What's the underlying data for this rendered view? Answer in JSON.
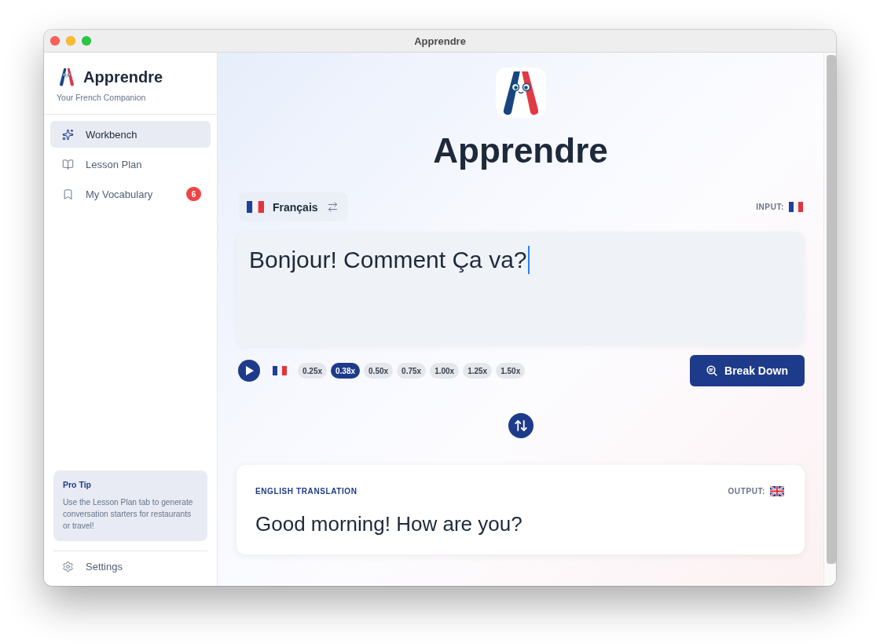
{
  "window": {
    "title": "Apprendre"
  },
  "sidebar": {
    "brand": "Apprendre",
    "tagline": "Your French Companion",
    "items": [
      {
        "kind": "sparkles",
        "label": "Workbench",
        "selected": true
      },
      {
        "kind": "book",
        "label": "Lesson Plan",
        "selected": false
      },
      {
        "kind": "bookmark",
        "label": "My Vocabulary",
        "selected": false,
        "badge": "6"
      }
    ],
    "tip": {
      "title": "Pro Tip",
      "text": "Use the Lesson Plan tab to generate conversation starters for restaurants or travel!"
    },
    "settings": {
      "label": "Settings"
    }
  },
  "main": {
    "title": "Apprendre",
    "language": {
      "label": "Français"
    },
    "input_label": "INPUT:",
    "input": {
      "value": "Bonjour! Comment Ça va?",
      "focused": true
    },
    "speeds": [
      {
        "label": "0.25x",
        "selected": false
      },
      {
        "label": "0.38x",
        "selected": true
      },
      {
        "label": "0.50x",
        "selected": false
      },
      {
        "label": "0.75x",
        "selected": false
      },
      {
        "label": "1.00x",
        "selected": false
      },
      {
        "label": "1.25x",
        "selected": false
      },
      {
        "label": "1.50x",
        "selected": false
      }
    ],
    "action": {
      "label": "Break Down"
    },
    "output": {
      "heading": "ENGLISH TRANSLATION",
      "label": "OUTPUT:",
      "text": "Good morning! How are you?"
    }
  }
}
